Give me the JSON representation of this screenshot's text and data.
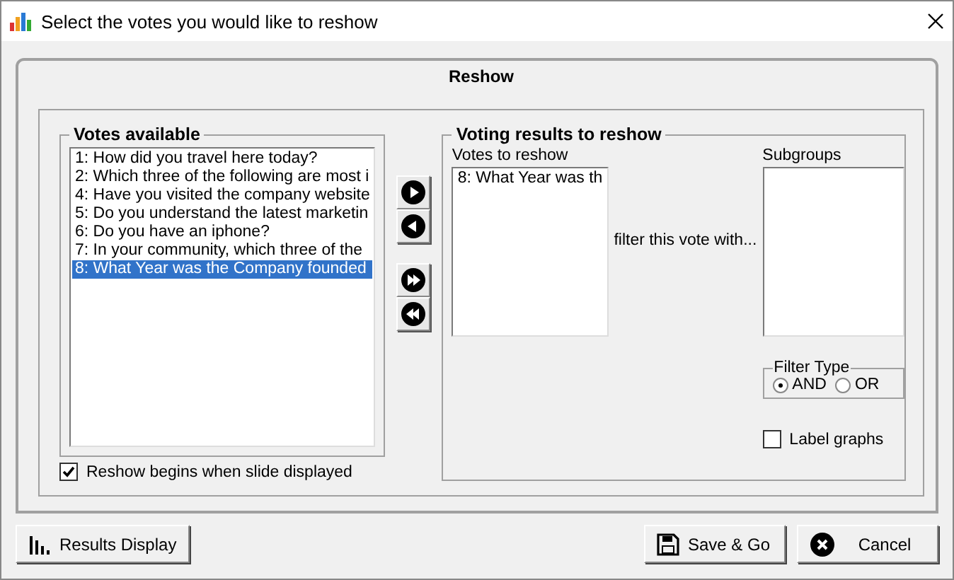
{
  "window": {
    "title": "Select the votes you would like to reshow"
  },
  "panel": {
    "title": "Reshow"
  },
  "votes_available": {
    "title": "Votes available",
    "items": [
      {
        "label": "1: How did you travel here today?",
        "selected": false
      },
      {
        "label": "2: Which three of the following are most i",
        "selected": false
      },
      {
        "label": "4: Have you visited the company website",
        "selected": false
      },
      {
        "label": "5: Do you understand the latest marketin",
        "selected": false
      },
      {
        "label": "6: Do you have an iphone?",
        "selected": false
      },
      {
        "label": "7: In your community, which three of the",
        "selected": false
      },
      {
        "label": "8: What Year was the Company founded",
        "selected": true
      }
    ]
  },
  "reshow_on_slide": {
    "label": "Reshow begins when slide displayed",
    "checked": true
  },
  "move_buttons": [
    {
      "kind": "add"
    },
    {
      "kind": "remove"
    },
    {
      "kind": "add_all"
    },
    {
      "kind": "remove_all"
    }
  ],
  "results": {
    "title": "Voting results to reshow",
    "votes_label": "Votes to reshow",
    "votes": [
      {
        "label": "8: What Year was th"
      }
    ],
    "filter_text": "filter this vote with...",
    "subgroups_label": "Subgroups",
    "filter_type": {
      "title": "Filter Type",
      "options": [
        {
          "label": "AND",
          "selected": true
        },
        {
          "label": "OR",
          "selected": false
        }
      ]
    },
    "label_graphs": {
      "label": "Label graphs",
      "checked": false
    }
  },
  "buttons": [
    {
      "kind": "chart",
      "label": "Results Display"
    },
    {
      "kind": "save",
      "label": "Save & Go"
    },
    {
      "kind": "cancel",
      "label": "Cancel"
    }
  ]
}
